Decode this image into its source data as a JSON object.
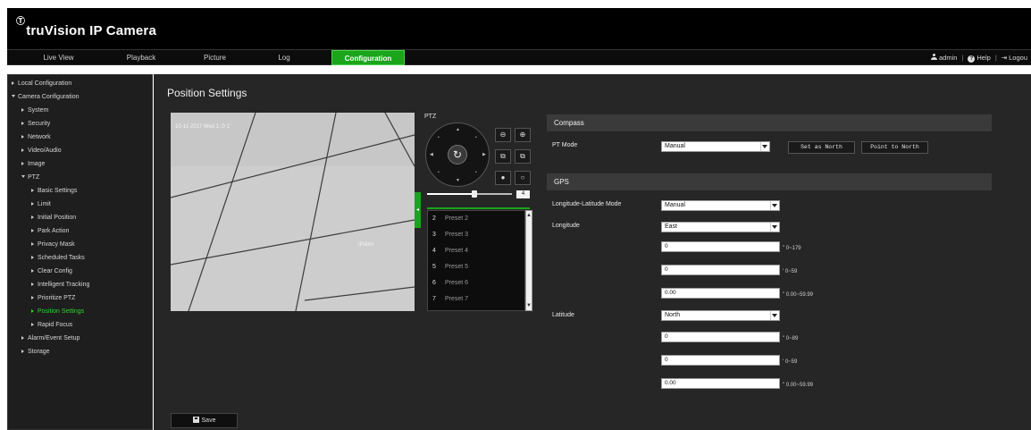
{
  "app": {
    "brand_mark": "Ⓣ",
    "title": "truVision  IP Camera"
  },
  "nav": {
    "tabs": [
      {
        "label": "Live View"
      },
      {
        "label": "Playback"
      },
      {
        "label": "Picture"
      },
      {
        "label": "Log"
      },
      {
        "label": "Configuration"
      }
    ],
    "active_tab": "Configuration",
    "user": "admin",
    "help": "Help",
    "logout": "Logou"
  },
  "sidebar": {
    "items": [
      {
        "label": "Local Configuration"
      },
      {
        "label": "Camera Configuration"
      },
      {
        "label": "System"
      },
      {
        "label": "Security"
      },
      {
        "label": "Network"
      },
      {
        "label": "Video/Audio"
      },
      {
        "label": "Image"
      },
      {
        "label": "PTZ"
      },
      {
        "label": "Basic Settings"
      },
      {
        "label": "Limit"
      },
      {
        "label": "Initial Position"
      },
      {
        "label": "Park Action"
      },
      {
        "label": "Privacy Mask"
      },
      {
        "label": "Scheduled Tasks"
      },
      {
        "label": "Clear Config"
      },
      {
        "label": "Intelligent Tracking"
      },
      {
        "label": "Prioritize PTZ"
      },
      {
        "label": "Position Settings"
      },
      {
        "label": "Rapid Focus"
      },
      {
        "label": "Alarm/Event Setup"
      },
      {
        "label": "Storage"
      }
    ],
    "active_item": "Position Settings"
  },
  "page": {
    "title": "Position Settings",
    "save_label": "Save"
  },
  "video": {
    "osd_date": "10-11-2017 Wed 1 :0 1'",
    "osd_camera": "IPdom"
  },
  "ptz": {
    "label": "PTZ",
    "center_glyph": "↻",
    "speed": "4",
    "presets": [
      {
        "num": "2",
        "name": "Preset 2"
      },
      {
        "num": "3",
        "name": "Preset 3"
      },
      {
        "num": "4",
        "name": "Preset 4"
      },
      {
        "num": "5",
        "name": "Preset 5"
      },
      {
        "num": "6",
        "name": "Preset 6"
      },
      {
        "num": "7",
        "name": "Preset 7"
      }
    ]
  },
  "compass": {
    "section_title": "Compass",
    "pt_mode_label": "PT Mode",
    "pt_mode_value": "Manual",
    "set_north_label": "Set as North",
    "point_north_label": "Point to North"
  },
  "gps": {
    "section_title": "GPS",
    "mode_label": "Longitude-Latitude Mode",
    "mode_value": "Manual",
    "longitude_label": "Longitude",
    "longitude_dir": "East",
    "longitude_deg": "0",
    "longitude_deg_range": "0~179",
    "longitude_min": "0",
    "longitude_min_range": "0~59",
    "longitude_sec": "0.00",
    "longitude_sec_range": "0.00~59.99",
    "latitude_label": "Latitude",
    "latitude_dir": "North",
    "latitude_deg": "0",
    "latitude_deg_range": "0~89",
    "latitude_min": "0",
    "latitude_min_range": "0~59",
    "latitude_sec": "0.00",
    "latitude_sec_range": "0.00~59.99"
  }
}
